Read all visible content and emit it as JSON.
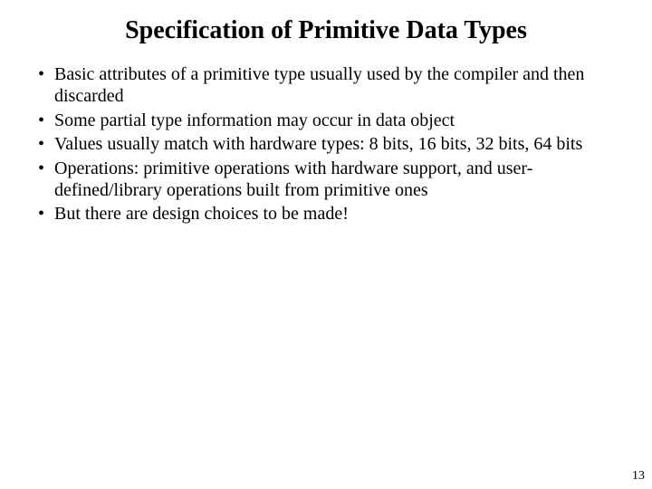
{
  "slide": {
    "title": "Specification of Primitive Data Types",
    "bullets": [
      "Basic attributes of a primitive type usually used by the compiler and then discarded",
      "Some partial type information may occur in data object",
      "Values usually match with hardware types: 8 bits, 16 bits, 32 bits, 64 bits",
      "Operations: primitive operations with hardware support, and user-defined/library operations built from primitive ones",
      "But there are design choices to be made!"
    ],
    "pageNumber": "13"
  }
}
